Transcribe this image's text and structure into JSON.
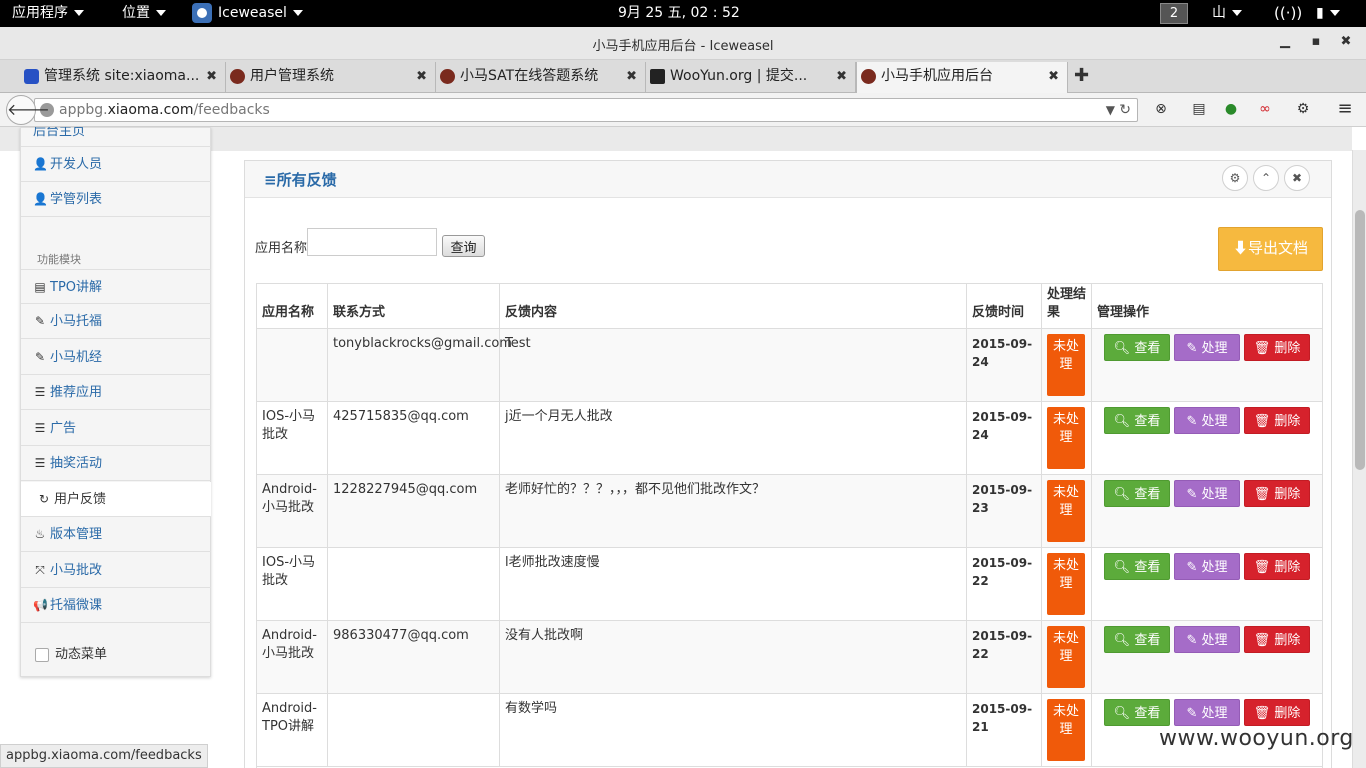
{
  "topbar": {
    "apps": "应用程序",
    "places": "位置",
    "browser": "Iceweasel",
    "clock": "9月 25 五, 02 : 52",
    "workspace": "2",
    "input_method": "山"
  },
  "window": {
    "title": "小马手机应用后台 - Iceweasel"
  },
  "tabs": [
    {
      "label": "管理系统 site:xiaoma..."
    },
    {
      "label": "用户管理系统"
    },
    {
      "label": "小马SAT在线答题系统"
    },
    {
      "label": "WooYun.org | 提交..."
    },
    {
      "label": "小马手机应用后台"
    }
  ],
  "url": {
    "prefix": "appbg.",
    "host": "xiaoma.com",
    "path": "/feedbacks"
  },
  "sidebar": {
    "top_cut": "后台主页",
    "items_a": [
      {
        "label": "开发人员"
      },
      {
        "label": "学管列表"
      }
    ],
    "section": "功能模块",
    "items_b": [
      {
        "label": "TPO讲解"
      },
      {
        "label": "小马托福"
      },
      {
        "label": "小马机经"
      },
      {
        "label": "推荐应用"
      },
      {
        "label": "广告"
      },
      {
        "label": "抽奖活动"
      },
      {
        "label": "用户反馈"
      },
      {
        "label": "版本管理"
      },
      {
        "label": "小马批改"
      },
      {
        "label": "托福微课"
      }
    ],
    "dynamic_menu": "动态菜单"
  },
  "panel": {
    "title": "所有反馈"
  },
  "filter": {
    "label": "应用名称",
    "value": "",
    "button": "查询"
  },
  "export_button": "导出文档",
  "table": {
    "headers": {
      "app": "应用名称",
      "contact": "联系方式",
      "content": "反馈内容",
      "time": "反馈时间",
      "result": "处理结果",
      "ops": "管理操作"
    },
    "rows": [
      {
        "app": "",
        "contact": "tonyblackrocks@gmail.com",
        "content": "Test",
        "time": "2015-09-24",
        "status": "未处理"
      },
      {
        "app": "IOS-小马批改",
        "contact": "425715835@qq.com",
        "content": "j近一个月无人批改",
        "time": "2015-09-24",
        "status": "未处理"
      },
      {
        "app": "Android-小马批改",
        "contact": "1228227945@qq.com",
        "content": "老师好忙的？？？，，，都不见他们批改作文？",
        "time": "2015-09-23",
        "status": "未处理"
      },
      {
        "app": "IOS-小马批改",
        "contact": "",
        "content": "l老师批改速度慢",
        "time": "2015-09-22",
        "status": "未处理"
      },
      {
        "app": "Android-小马批改",
        "contact": "986330477@qq.com",
        "content": "没有人批改啊",
        "time": "2015-09-22",
        "status": "未处理"
      },
      {
        "app": "Android-TPO讲解",
        "contact": "",
        "content": "有数学吗",
        "time": "2015-09-21",
        "status": "未处理"
      }
    ],
    "actions": {
      "view": "查看",
      "process": "处理",
      "delete": "删除"
    }
  },
  "statusbar": "appbg.xiaoma.com/feedbacks",
  "watermark": "www.wooyun.org"
}
